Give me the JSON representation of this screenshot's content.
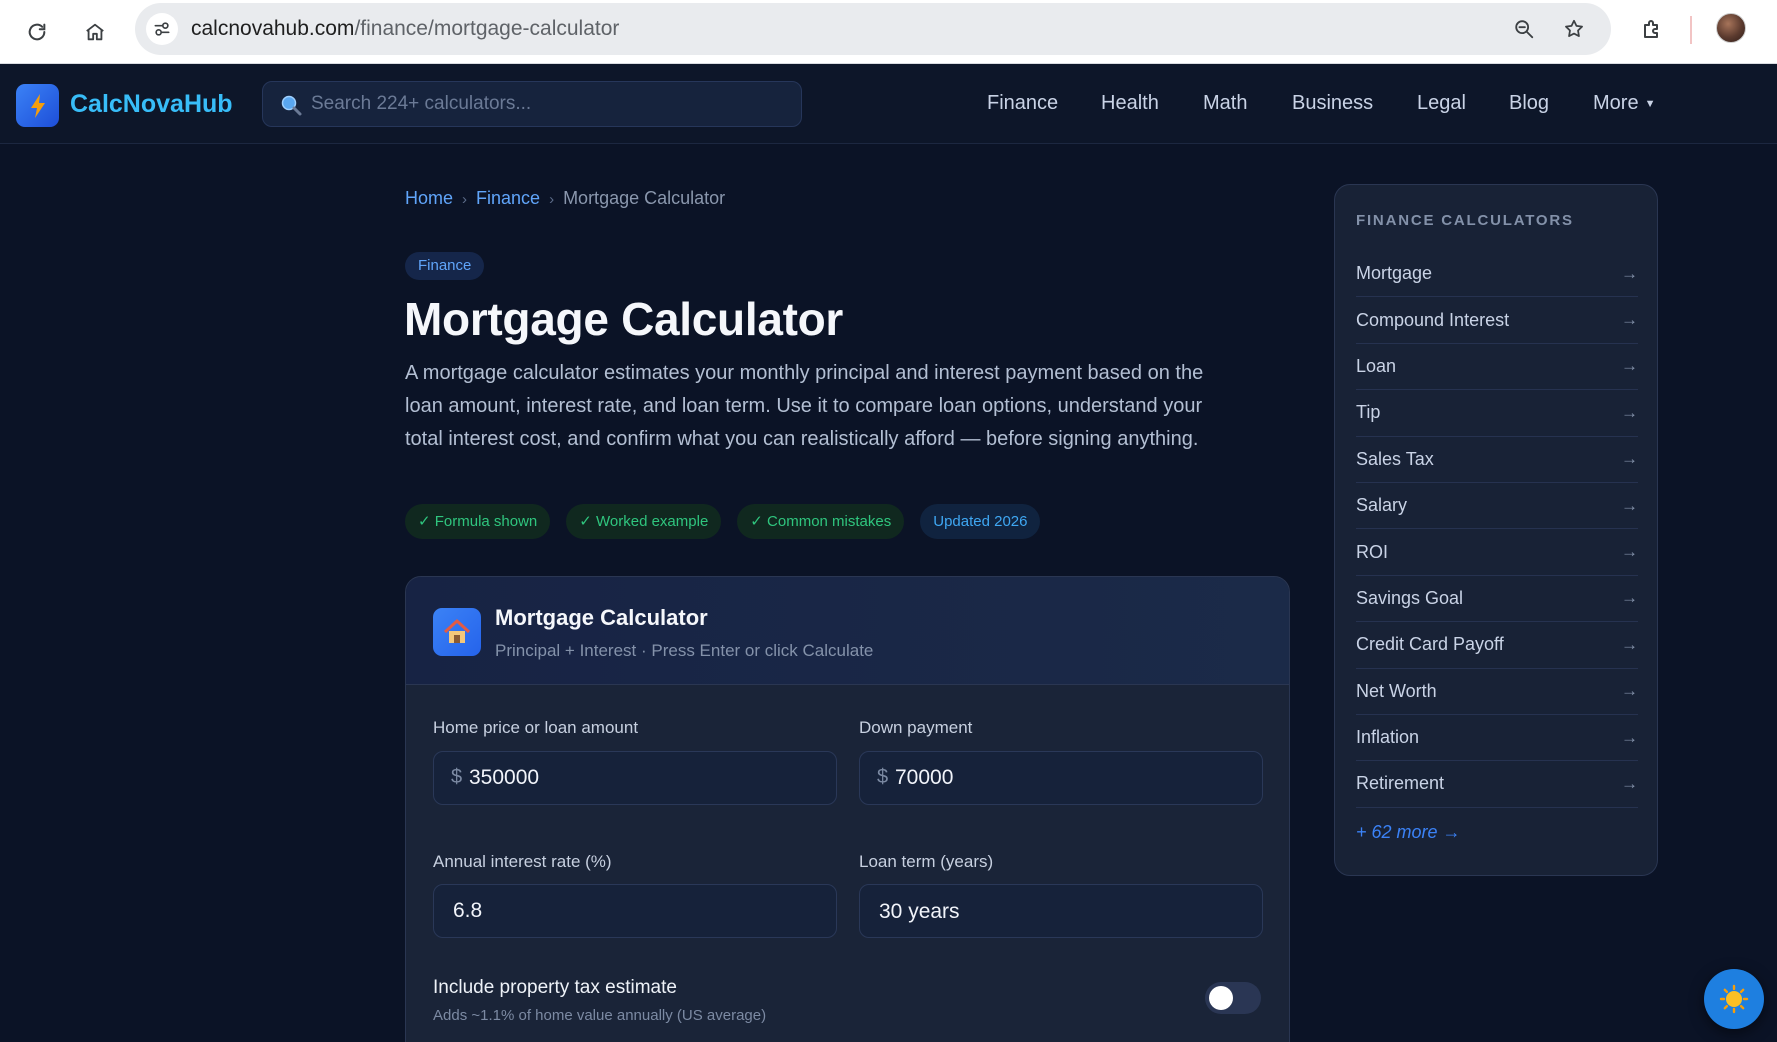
{
  "browser": {
    "url_domain": "calcnovahub.com",
    "url_path": "/finance/mortgage-calculator"
  },
  "header": {
    "logo_text": "CalcNovaHub",
    "search_placeholder": "Search 224+ calculators...",
    "nav": [
      {
        "label": "Finance"
      },
      {
        "label": "Health"
      },
      {
        "label": "Math"
      },
      {
        "label": "Business"
      },
      {
        "label": "Legal"
      },
      {
        "label": "Blog"
      },
      {
        "label": "More"
      }
    ]
  },
  "breadcrumb": {
    "home": "Home",
    "category": "Finance",
    "current": "Mortgage Calculator",
    "separator": "›"
  },
  "page": {
    "category_badge": "Finance",
    "title": "Mortgage Calculator",
    "intro": "A mortgage calculator estimates your monthly principal and interest payment based on the loan amount, interest rate, and loan term. Use it to compare loan options, understand your total interest cost, and confirm what you can realistically afford — before signing anything.",
    "tags": [
      {
        "label": "✓ Formula shown",
        "color": "green"
      },
      {
        "label": "✓ Worked example",
        "color": "green"
      },
      {
        "label": "✓ Common mistakes",
        "color": "green"
      },
      {
        "label": "Updated 2026",
        "color": "blue"
      }
    ]
  },
  "calculator": {
    "title": "Mortgage Calculator",
    "subtitle": "Principal + Interest · Press Enter or click Calculate",
    "fields": {
      "home_price": {
        "label": "Home price or loan amount",
        "prefix": "$",
        "value": "350000"
      },
      "down_payment": {
        "label": "Down payment",
        "prefix": "$",
        "value": "70000"
      },
      "interest_rate": {
        "label": "Annual interest rate (%)",
        "value": "6.8"
      },
      "loan_term": {
        "label": "Loan term (years)",
        "value": "30 years"
      }
    },
    "property_tax_toggle": {
      "title": "Include property tax estimate",
      "subtitle": "Adds ~1.1% of home value annually (US average)",
      "enabled": false
    }
  },
  "sidebar": {
    "title": "FINANCE CALCULATORS",
    "arrow": "→",
    "items": [
      {
        "label": "Mortgage"
      },
      {
        "label": "Compound Interest"
      },
      {
        "label": "Loan"
      },
      {
        "label": "Tip"
      },
      {
        "label": "Sales Tax"
      },
      {
        "label": "Salary"
      },
      {
        "label": "ROI"
      },
      {
        "label": "Savings Goal"
      },
      {
        "label": "Credit Card Payoff"
      },
      {
        "label": "Net Worth"
      },
      {
        "label": "Inflation"
      },
      {
        "label": "Retirement"
      }
    ],
    "more_link": "+ 62 more →"
  },
  "colors": {
    "page_bg": "#0b1326",
    "accent_blue": "#3b82f6",
    "link_blue": "#60a5fa",
    "logo_cyan": "#38bdf8",
    "tag_green": "#2fc57e"
  },
  "icons": {
    "reload": "reload-icon",
    "home": "home-icon",
    "site_settings": "site-settings-icon",
    "zoom": "zoom-icon",
    "bookmark": "star-icon",
    "extensions": "puzzle-icon",
    "logo": "lightning-bolt-icon",
    "search": "magnifier-icon",
    "calculator": "house-icon",
    "floating": "sun-icon"
  }
}
